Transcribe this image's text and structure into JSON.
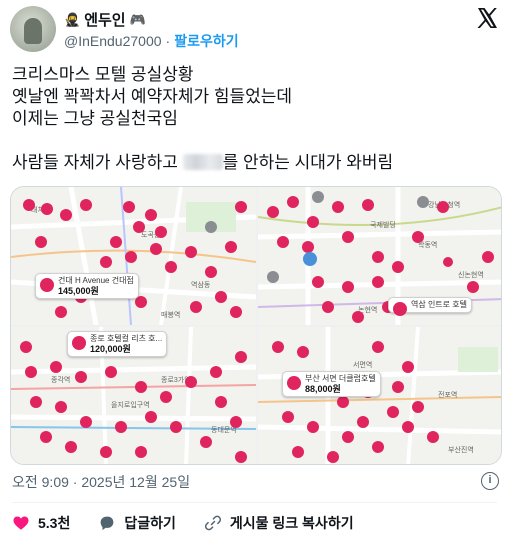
{
  "author": {
    "display_name": "엔두인",
    "name_prefix_icon": "ninja-emoji-icon",
    "name_suffix_icon": "gamepad-emoji-icon",
    "handle": "@InEndu27000",
    "separator": "·",
    "follow_label": "팔로우하기"
  },
  "platform_logo": "x-logo-icon",
  "tweet": {
    "lines": [
      "크리스마스 모텔 공실상황",
      "옛날엔 꽉꽉차서 예약자체가 힘들었는데",
      "이제는 그냥 공실천국임",
      "",
      "사람들 자체가 사랑하고",
      "를 안하는 시대가 와버림"
    ]
  },
  "media": {
    "maps": [
      {
        "labels": [
          "대치동",
          "도곡동",
          "역삼동",
          "매봉역"
        ],
        "price_tag": null
      },
      {
        "labels": [
          "국제빌딩",
          "강남구청역",
          "학동역",
          "신논현역",
          "논현역"
        ],
        "price_tag": null
      },
      {
        "labels": [
          "종로3가역",
          "을지로입구역",
          "종각역",
          "동대문역"
        ],
        "price_tag": {
          "name": "종로 호텔컬 리츠 호...",
          "price": "120,000원"
        }
      },
      {
        "labels": [
          "서면역",
          "전포역",
          "부산진역"
        ],
        "price_tag": {
          "name": "부산 서면 더클럽호텔",
          "price": "88,000원"
        }
      }
    ],
    "extra_price_tags": [
      {
        "name": "건대 H Avenue 건대점",
        "price": "145,000원"
      },
      {
        "name": "역삼 인트로 호텔",
        "price": ""
      }
    ]
  },
  "meta": {
    "time": "오전 9:09",
    "separator": "·",
    "date": "2025년 12월 25일"
  },
  "actions": {
    "like_count": "5.3천",
    "reply_label": "답글하기",
    "copy_link_label": "게시물 링크 복사하기"
  },
  "colors": {
    "accent": "#1d9bf0",
    "like_red": "#f91880",
    "pin_red": "#e0245e",
    "secondary_text": "#536471"
  }
}
